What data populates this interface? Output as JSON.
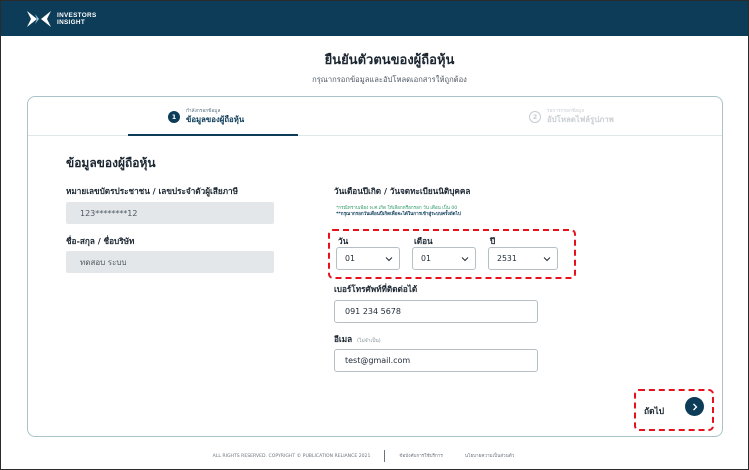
{
  "brand": {
    "line1": "INVESTORS",
    "line2": "INSIGHT"
  },
  "header": {
    "title": "ยืนยันตัวตนของผู้ถือหุ้น",
    "subtitle": "กรุณากรอกข้อมูลและอัปโหลดเอกสารให้ถูกต้อง"
  },
  "steps": [
    {
      "number": "1",
      "small": "กำลังกรอกข้อมูล",
      "label": "ข้อมูลของผู้ถือหุ้น",
      "active": true
    },
    {
      "number": "2",
      "small": "รอการกรอกข้อมูล",
      "label": "อัปโหลดไฟล์รูปภาพ",
      "active": false
    }
  ],
  "form": {
    "section_title": "ข้อมูลของผู้ถือหุ้น",
    "id_label": "หมายเลขบัตรประชาชน / เลขประจำตัวผู้เสียภาษี",
    "id_value": "123********12",
    "name_label": "ชื่อ-สกุล / ชื่อบริษัท",
    "name_value": "ทดสอบ ระบบ",
    "dob_label": "วันเดือนปีเกิด / วันจดทะเบียนนิติบุคคล",
    "dob_note_1": "*กรณีทราบเพียง พ.ศ.เกิด ให้เลือกหรือกรอก วัน เดือน เป็น 00",
    "dob_note_2": "**กรุณากรอกวันเดือนปีเกิดเพื่อจะได้ในการเข้าสู่ระบบครั้งถัดไป",
    "day_label": "วัน",
    "day_value": "01",
    "month_label": "เดือน",
    "month_value": "01",
    "year_label": "ปี",
    "year_value": "2531",
    "phone_label": "เบอร์โทรศัพท์ที่ติดต่อได้",
    "phone_value": "091 234 5678",
    "email_label": "อีเมล",
    "email_optional": "(ไม่จำเป็น)",
    "email_value": "test@gmail.com"
  },
  "next_label": "ถัดไป",
  "footer": {
    "copyright": "ALL RIGHTS RESERVED. COPYRIGHT © PUBLICATION RELIANCE 2021",
    "terms": "ข้อบังคับการใช้บริการ",
    "privacy": "นโยบายความเป็นส่วนตัว"
  },
  "colors": {
    "brand_navy": "#0c3c58",
    "highlight_red": "#e6111a",
    "note_green": "#2d9a67"
  },
  "icons": {
    "logo": "investors-insight-logo",
    "chevron": "chevron-down-icon",
    "next": "chevron-right-icon"
  }
}
